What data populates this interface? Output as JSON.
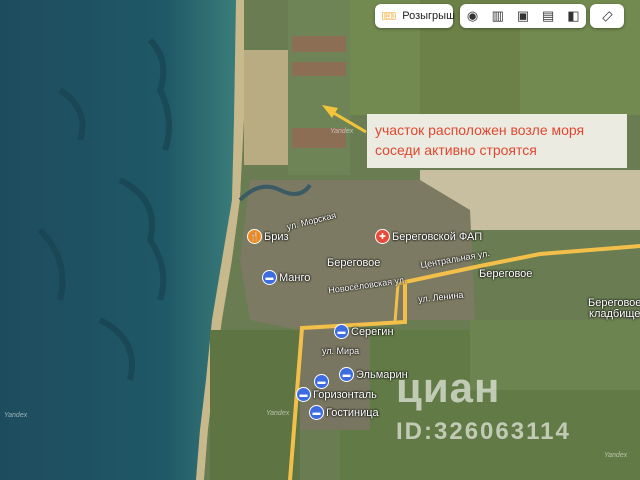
{
  "toolbar": {
    "raffle_label": "Розыгрыш",
    "raffle_icon": "ticket-icon",
    "layer_icons": [
      "panorama-icon",
      "atlas-icon",
      "photo-icon",
      "transit-icon",
      "layers-icon"
    ],
    "ruler_icon": "ruler-icon"
  },
  "annotation": {
    "line1": "участок расположен возле моря",
    "line2": "соседи активно строятся",
    "color": "#e2472f"
  },
  "places": {
    "village": "Береговое",
    "village_east": "Береговое",
    "cemetery_line1": "Береговое",
    "cemetery_line2": "кладбище",
    "street_morskaya": "ул. Морская",
    "street_novoselovskaya": "Новосёловская ул.",
    "street_centralnaya": "Центральная ул.",
    "street_lenina": "ул. Ленина",
    "street_mira": "ул. Мира"
  },
  "pois": {
    "briz": "Бриз",
    "fap": "Береговской ФАП",
    "mango": "Манго",
    "seregin": "Серегин",
    "elmarin": "Эльмарин",
    "gorizontal": "Горизонталь",
    "gostinitsa": "Гостиница"
  },
  "watermark": {
    "logo": "циан",
    "id": "ID:326063114",
    "yandex": "Yandex"
  },
  "colors": {
    "sea": "#1d4f5e",
    "road": "#f2c04a",
    "hotel": "#3d6be0",
    "food": "#f08a1c",
    "medical": "#e84a3a"
  }
}
